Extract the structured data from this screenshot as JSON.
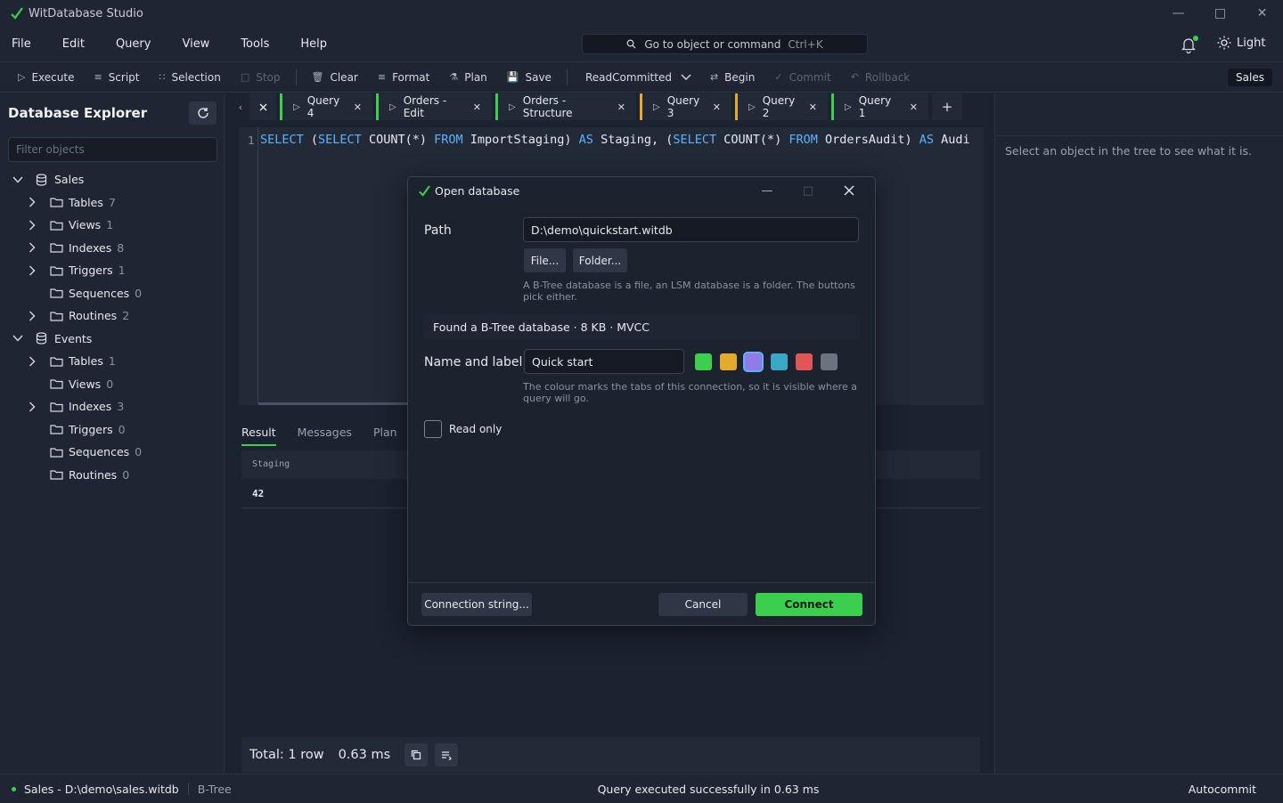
{
  "window": {
    "title": "WitDatabase Studio"
  },
  "menu": [
    "File",
    "Edit",
    "Query",
    "View",
    "Tools",
    "Help"
  ],
  "command_search": {
    "placeholder": "Go to object or command",
    "shortcut": "Ctrl+K"
  },
  "theme_toggle": "Light",
  "toolbar": {
    "execute": "Execute",
    "script": "Script",
    "selection": "Selection",
    "stop": "Stop",
    "clear": "Clear",
    "format": "Format",
    "plan": "Plan",
    "save": "Save",
    "isolation": "ReadCommitted",
    "begin": "Begin",
    "commit": "Commit",
    "rollback": "Rollback",
    "connection": "Sales"
  },
  "explorer": {
    "title": "Database Explorer",
    "filter_placeholder": "Filter objects",
    "databases": [
      {
        "name": "Sales",
        "children": [
          {
            "label": "Tables",
            "count": "7",
            "expandable": true
          },
          {
            "label": "Views",
            "count": "1",
            "expandable": true
          },
          {
            "label": "Indexes",
            "count": "8",
            "expandable": true
          },
          {
            "label": "Triggers",
            "count": "1",
            "expandable": true
          },
          {
            "label": "Sequences",
            "count": "0",
            "expandable": false
          },
          {
            "label": "Routines",
            "count": "2",
            "expandable": true
          }
        ]
      },
      {
        "name": "Events",
        "children": [
          {
            "label": "Tables",
            "count": "1",
            "expandable": true
          },
          {
            "label": "Views",
            "count": "0",
            "expandable": false
          },
          {
            "label": "Indexes",
            "count": "3",
            "expandable": true
          },
          {
            "label": "Triggers",
            "count": "0",
            "expandable": false
          },
          {
            "label": "Sequences",
            "count": "0",
            "expandable": false
          },
          {
            "label": "Routines",
            "count": "0",
            "expandable": false
          }
        ]
      }
    ]
  },
  "tabs": [
    {
      "label": "Query 4",
      "color": "#3ccf4e"
    },
    {
      "label": "Orders - Edit",
      "color": "#3ccf4e"
    },
    {
      "label": "Orders - Structure",
      "color": "#3ccf4e"
    },
    {
      "label": "Query 3",
      "color": "#e5a92b"
    },
    {
      "label": "Query 2",
      "color": "#e5a92b"
    },
    {
      "label": "Query 1",
      "color": "#3ccf4e"
    }
  ],
  "editor": {
    "line_number": "1",
    "code_tokens": [
      {
        "t": "SELECT",
        "kw": true
      },
      {
        "t": " (",
        "kw": false
      },
      {
        "t": "SELECT",
        "kw": true
      },
      {
        "t": " COUNT(*) ",
        "kw": false
      },
      {
        "t": "FROM",
        "kw": true
      },
      {
        "t": " ImportStaging) ",
        "kw": false
      },
      {
        "t": "AS",
        "kw": true
      },
      {
        "t": " Staging, (",
        "kw": false
      },
      {
        "t": "SELECT",
        "kw": true
      },
      {
        "t": " COUNT(*) ",
        "kw": false
      },
      {
        "t": "FROM",
        "kw": true
      },
      {
        "t": " OrdersAudit) ",
        "kw": false
      },
      {
        "t": "AS",
        "kw": true
      },
      {
        "t": " Audi",
        "kw": false
      }
    ]
  },
  "results": {
    "tabs": [
      "Result",
      "Messages",
      "Plan"
    ],
    "column": "Staging",
    "value": "42",
    "total": "Total: 1 row",
    "time": "0.63 ms"
  },
  "details": {
    "hint": "Select an object in the tree to see what it is."
  },
  "statusbar": {
    "connection": "Sales - D:\\demo\\sales.witdb",
    "engine": "B-Tree",
    "message": "Query executed successfully in 0.63 ms",
    "mode": "Autocommit"
  },
  "dialog": {
    "title": "Open database",
    "path_label": "Path",
    "path_value": "D:\\demo\\quickstart.witdb",
    "file_button": "File...",
    "folder_button": "Folder...",
    "path_help": "A B-Tree database is a file, an LSM database is a folder. The buttons pick either.",
    "found": "Found a B-Tree database · 8 KB · MVCC",
    "name_label": "Name and label",
    "name_value": "Quick start",
    "colors": [
      "#3ccf4e",
      "#e5a92b",
      "#8f7ce6",
      "#3aa7c6",
      "#e05555",
      "#6b7280"
    ],
    "selected_color": 2,
    "color_help": "The colour marks the tabs of this connection, so it is visible where a query will go.",
    "read_only": "Read only",
    "connection_string": "Connection string...",
    "cancel": "Cancel",
    "connect": "Connect"
  }
}
